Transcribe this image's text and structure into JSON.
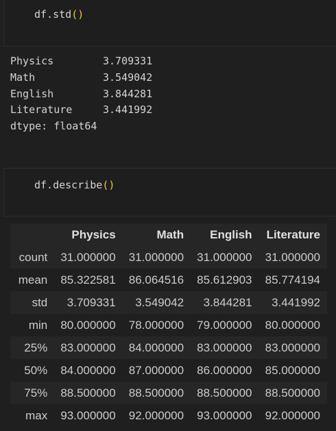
{
  "cells": [
    {
      "code": {
        "prefix": "df.std",
        "args": "()"
      },
      "output": {
        "rows": [
          {
            "name": "Physics",
            "value": "3.709331"
          },
          {
            "name": "Math",
            "value": "3.549042"
          },
          {
            "name": "English",
            "value": "3.844281"
          },
          {
            "name": "Literature",
            "value": "3.441992"
          }
        ],
        "dtype": "dtype: float64"
      }
    },
    {
      "code": {
        "prefix": "df.describe",
        "args": "()"
      },
      "table": {
        "columns": [
          "Physics",
          "Math",
          "English",
          "Literature"
        ],
        "rows": [
          {
            "label": "count",
            "values": [
              "31.000000",
              "31.000000",
              "31.000000",
              "31.000000"
            ]
          },
          {
            "label": "mean",
            "values": [
              "85.322581",
              "86.064516",
              "85.612903",
              "85.774194"
            ]
          },
          {
            "label": "std",
            "values": [
              "3.709331",
              "3.549042",
              "3.844281",
              "3.441992"
            ]
          },
          {
            "label": "min",
            "values": [
              "80.000000",
              "78.000000",
              "79.000000",
              "80.000000"
            ]
          },
          {
            "label": "25%",
            "values": [
              "83.000000",
              "84.000000",
              "83.000000",
              "83.000000"
            ]
          },
          {
            "label": "50%",
            "values": [
              "84.000000",
              "87.000000",
              "86.000000",
              "85.000000"
            ]
          },
          {
            "label": "75%",
            "values": [
              "88.500000",
              "88.500000",
              "88.500000",
              "88.500000"
            ]
          },
          {
            "label": "max",
            "values": [
              "93.000000",
              "92.000000",
              "93.000000",
              "92.000000"
            ]
          }
        ]
      }
    }
  ],
  "colors": {
    "background": "#1f1f1f",
    "cell_input_bg": "#1e1e1e",
    "paren": "#f2c53d",
    "row_stripe": "#262626"
  }
}
